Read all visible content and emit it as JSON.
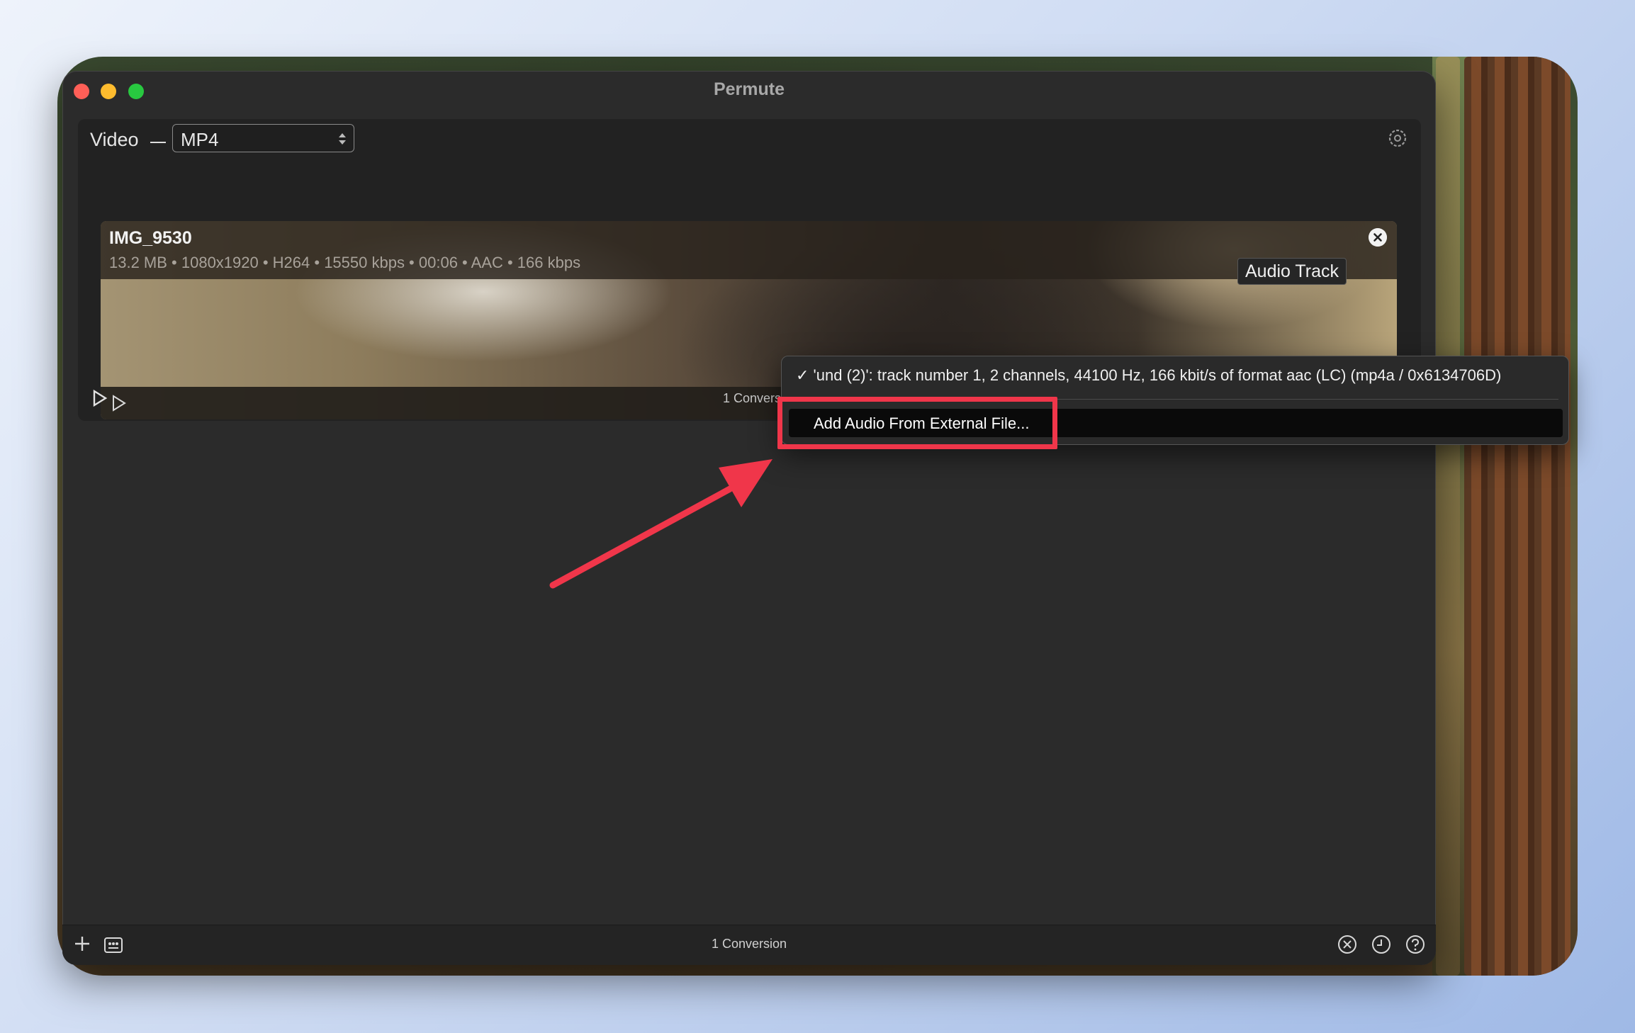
{
  "window": {
    "title": "Permute"
  },
  "format_bar": {
    "category": "Video",
    "format_value": "MP4"
  },
  "file": {
    "name": "IMG_9530",
    "meta": "13.2 MB • 1080x1920 • H264 • 15550 kbps • 00:06 • AAC • 166 kbps"
  },
  "tooltip": {
    "text": "Audio Track"
  },
  "convert": {
    "label_top": "1 Conversi"
  },
  "bottombar": {
    "label": "1 Conversion"
  },
  "audio_menu": {
    "items": [
      {
        "label": "✓ 'und (2)': track number 1, 2 channels, 44100 Hz, 166 kbit/s of format aac (LC) (mp4a / 0x6134706D)",
        "checked": true
      },
      {
        "label": "Add Audio From External File...",
        "highlighted": true
      }
    ]
  },
  "colors": {
    "window_bg": "#2b2b2b",
    "annotation": "#f0364a",
    "traffic_red": "#ff5f57",
    "traffic_yellow": "#febc2e",
    "traffic_green": "#28c840"
  },
  "icons": [
    "gear-icon",
    "close-icon",
    "play-icon",
    "crop-icon",
    "film-icon",
    "speaker-icon",
    "subtitle-icon",
    "settings-icon",
    "plus-icon",
    "monitor-icon",
    "cancel-icon",
    "clock-icon",
    "help-icon",
    "chevron-updown-icon"
  ]
}
